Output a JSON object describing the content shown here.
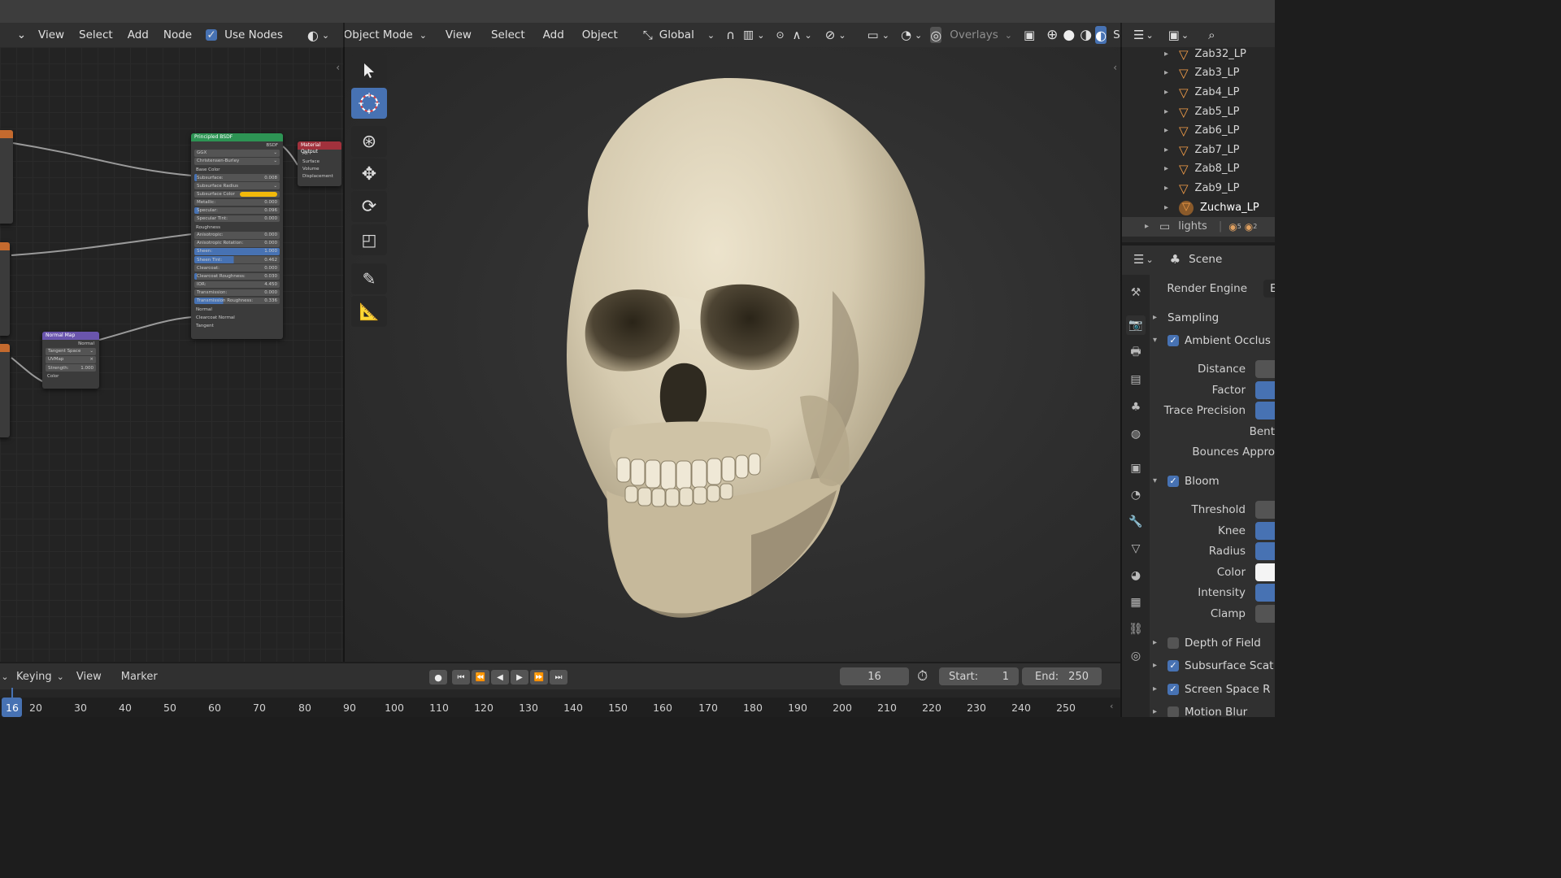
{
  "node_editor": {
    "menu": [
      "View",
      "Select",
      "Add",
      "Node"
    ],
    "use_nodes_label": "Use Nodes",
    "use_nodes_checked": true,
    "principled": {
      "title": "Principled BSDF",
      "output": "BSDF",
      "distribution": "GGX",
      "subsurface_method": "Christensen-Burley",
      "base_color_label": "Base Color",
      "fields": [
        {
          "label": "Subsurface:",
          "value": "0.008"
        },
        {
          "label": "Subsurface Radius",
          "value": ""
        },
        {
          "label": "Subsurface Color",
          "value": ""
        },
        {
          "label": "Metallic:",
          "value": "0.000"
        },
        {
          "label": "Specular:",
          "value": "0.096"
        },
        {
          "label": "Specular Tint:",
          "value": "0.000"
        },
        {
          "label": "Roughness",
          "value": ""
        },
        {
          "label": "Anisotropic:",
          "value": "0.000"
        },
        {
          "label": "Anisotropic Rotation:",
          "value": "0.000"
        },
        {
          "label": "Sheen:",
          "value": "1.000"
        },
        {
          "label": "Sheen Tint:",
          "value": "0.462"
        },
        {
          "label": "Clearcoat:",
          "value": "0.000"
        },
        {
          "label": "Clearcoat Roughness:",
          "value": "0.030"
        },
        {
          "label": "IOR:",
          "value": "4.450"
        },
        {
          "label": "Transmission:",
          "value": "0.000"
        },
        {
          "label": "Transmission Roughness:",
          "value": "0.336"
        }
      ],
      "inputs": [
        "Normal",
        "Clearcoat Normal",
        "Tangent"
      ]
    },
    "material_output": {
      "title": "Material Output",
      "target": "All",
      "sockets": [
        "Surface",
        "Volume",
        "Displacement"
      ]
    },
    "normal_map": {
      "title": "Normal Map",
      "output": "Normal",
      "space": "Tangent Space",
      "uv": "UVMap",
      "strength_label": "Strength:",
      "strength": "1.000",
      "input": "Color"
    }
  },
  "viewport": {
    "mode": "Object Mode",
    "menu": [
      "View",
      "Select",
      "Add",
      "Object"
    ],
    "orientation": "Global",
    "overlays_label": "Overlays",
    "cut_label": "Sl"
  },
  "outliner": {
    "items": [
      "Zab32_LP",
      "Zab3_LP",
      "Zab4_LP",
      "Zab5_LP",
      "Zab6_LP",
      "Zab7_LP",
      "Zab8_LP",
      "Zab9_LP",
      "Zuchwa_LP"
    ],
    "collection": "lights",
    "badges": [
      "5",
      "2"
    ]
  },
  "properties": {
    "context": "Scene",
    "render_engine_label": "Render Engine",
    "render_engine_value": "E",
    "sampling": "Sampling",
    "ao": {
      "title": "Ambient Occlus",
      "rows": [
        "Distance",
        "Factor",
        "Trace Precision",
        "Bent",
        "Bounces Appro"
      ]
    },
    "bloom": {
      "title": "Bloom",
      "rows": [
        "Threshold",
        "Knee",
        "Radius",
        "Color",
        "Intensity",
        "Clamp"
      ]
    },
    "collapsed": [
      {
        "label": "Depth of Field",
        "checked": false
      },
      {
        "label": "Subsurface Scat",
        "checked": true
      },
      {
        "label": "Screen Space R",
        "checked": true
      },
      {
        "label": "Motion Blur",
        "checked": false
      }
    ]
  },
  "timeline": {
    "menu": [
      "Keying",
      "View",
      "Marker"
    ],
    "current_frame": "16",
    "start_label": "Start:",
    "start": "1",
    "end_label": "End:",
    "end": "250",
    "ruler": [
      "16",
      "20",
      "30",
      "40",
      "50",
      "60",
      "70",
      "80",
      "90",
      "100",
      "110",
      "120",
      "130",
      "140",
      "150",
      "160",
      "170",
      "180",
      "190",
      "200",
      "210",
      "220",
      "230",
      "240",
      "250"
    ]
  },
  "colors": {
    "accent": "#4772b3",
    "bsdf_header": "#2d9454",
    "output_header": "#a1313c",
    "normalmap_header": "#6a55ad",
    "subsurface_color": "#f2b90a",
    "skull": "#d6cbb0"
  }
}
